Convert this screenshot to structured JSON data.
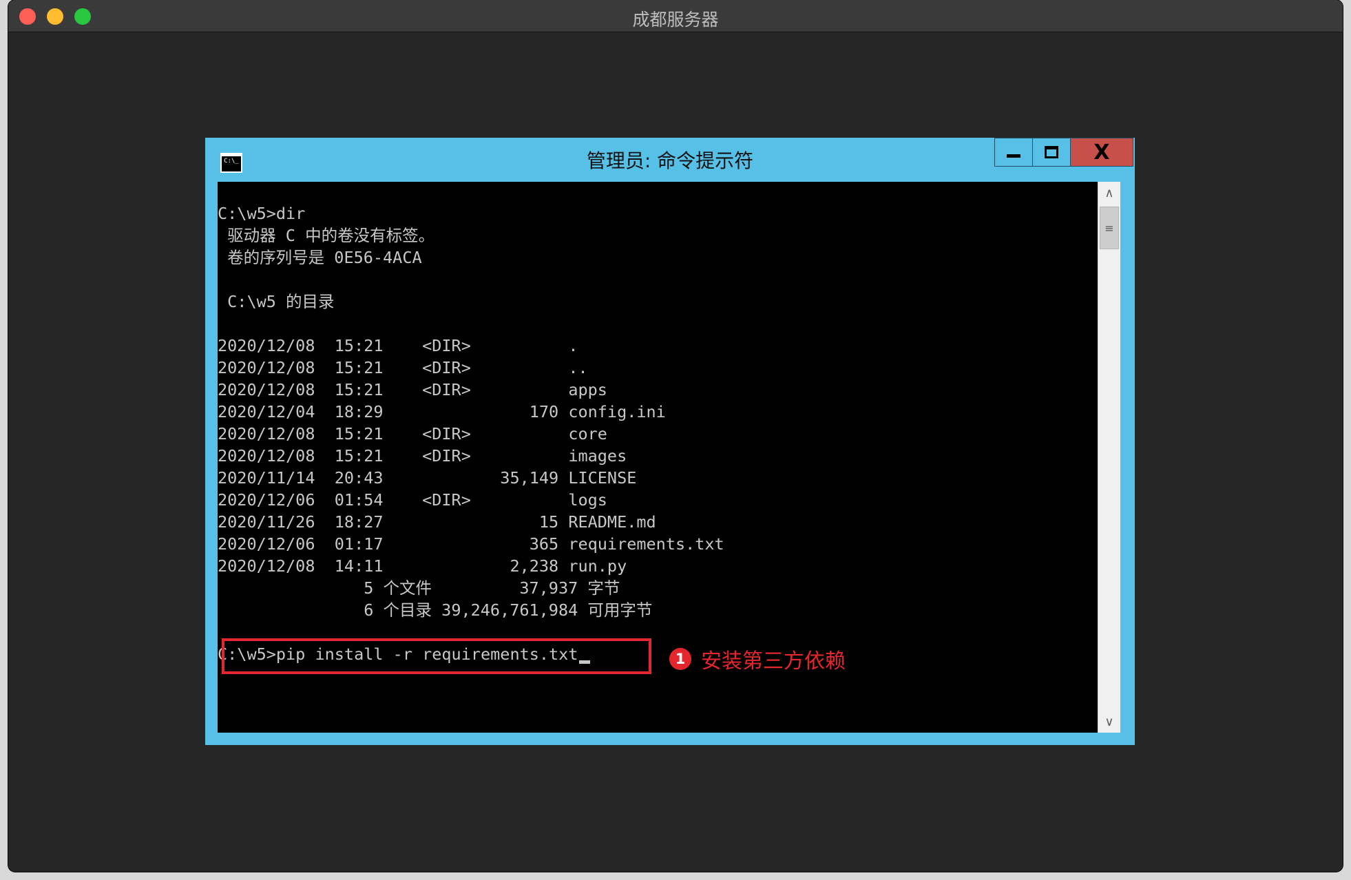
{
  "mac_window": {
    "title": "成都服务器"
  },
  "cmd_window": {
    "title": "管理员: 命令提示符",
    "icon_label": "C:\\_",
    "close_label": "X"
  },
  "console": {
    "lines": [
      "C:\\w5>dir",
      " 驱动器 C 中的卷没有标签。",
      " 卷的序列号是 0E56-4ACA",
      "",
      " C:\\w5 的目录",
      "",
      "2020/12/08  15:21    <DIR>          .",
      "2020/12/08  15:21    <DIR>          ..",
      "2020/12/08  15:21    <DIR>          apps",
      "2020/12/04  18:29               170 config.ini",
      "2020/12/08  15:21    <DIR>          core",
      "2020/12/08  15:21    <DIR>          images",
      "2020/11/14  20:43            35,149 LICENSE",
      "2020/12/06  01:54    <DIR>          logs",
      "2020/11/26  18:27                15 README.md",
      "2020/12/06  01:17               365 requirements.txt",
      "2020/12/08  14:11             2,238 run.py",
      "               5 个文件         37,937 字节",
      "               6 个目录 39,246,761,984 可用字节",
      "",
      "C:\\w5>pip install -r requirements.txt"
    ]
  },
  "annotation": {
    "number": "1",
    "text": "安装第三方依赖",
    "color": "#e4262d"
  },
  "colors": {
    "cmd_frame": "#57c0e6",
    "console_bg": "#000000",
    "console_text": "#c8c8c8"
  }
}
